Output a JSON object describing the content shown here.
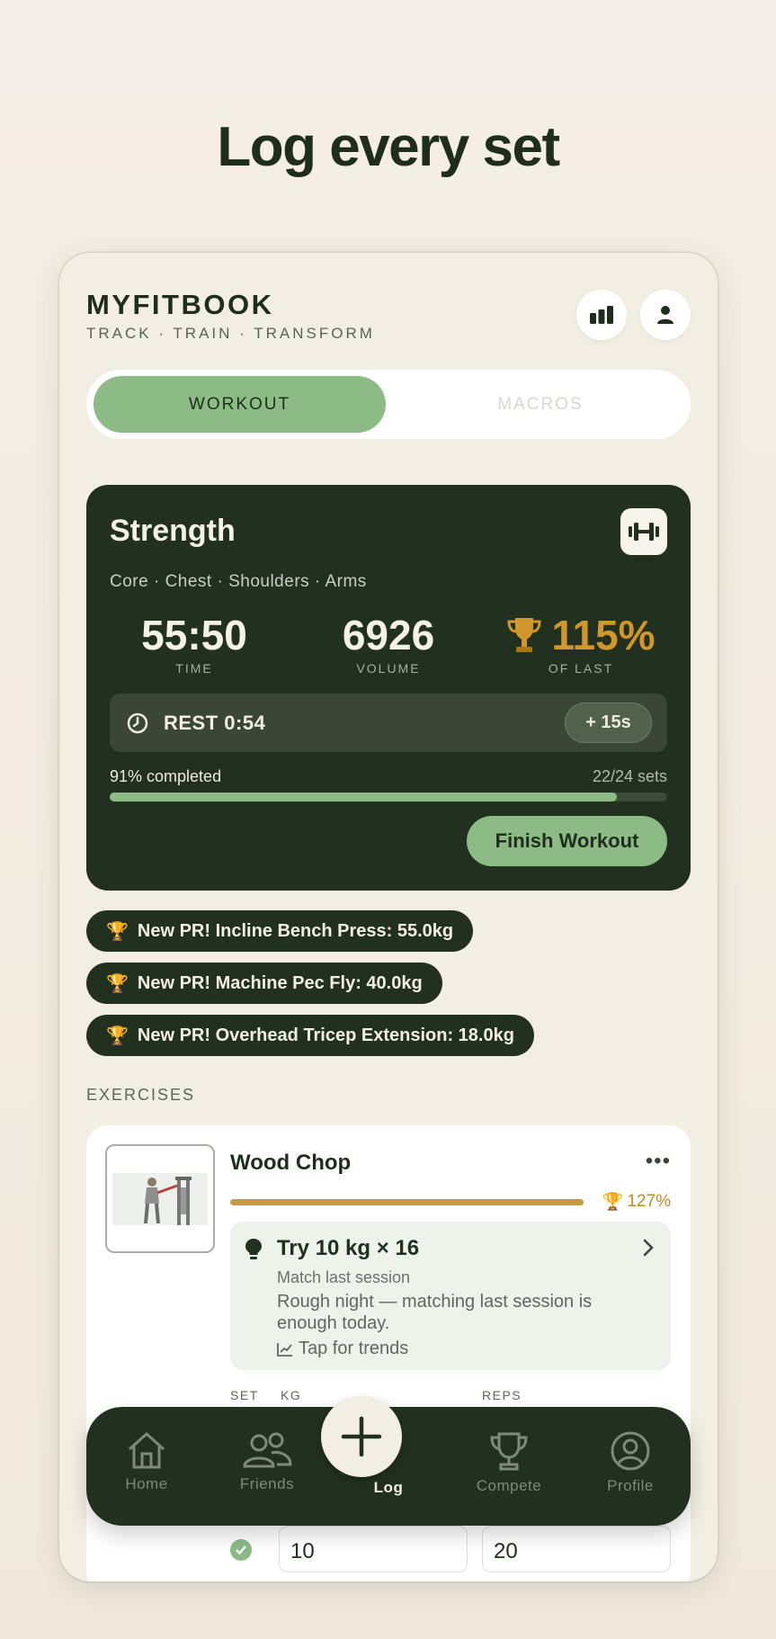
{
  "headline": "Log every set",
  "app": {
    "name": "MYFITBOOK",
    "tagline": "TRACK · TRAIN · TRANSFORM",
    "header_icons": [
      "bar-chart-icon",
      "user-icon"
    ]
  },
  "mode_tabs": {
    "active": "WORKOUT",
    "inactive": "MACROS"
  },
  "workout": {
    "title": "Strength",
    "muscles": "Core · Chest · Shoulders · Arms",
    "stats": [
      {
        "value": "55:50",
        "label": "TIME"
      },
      {
        "value": "6926",
        "label": "VOLUME"
      },
      {
        "value": "115%",
        "label": "OF LAST"
      }
    ],
    "rest_label": "REST 0:54",
    "add_rest_label": "+ 15s",
    "progress_text": "91% completed",
    "sets_text": "22/24 sets",
    "progress_fraction": 0.91,
    "finish_label": "Finish Workout"
  },
  "prs": [
    "New PR! Incline Bench Press: 55.0kg",
    "New PR! Machine Pec Fly: 40.0kg",
    "New PR! Overhead Tricep Extension: 18.0kg"
  ],
  "exercises_label": "EXERCISES",
  "exercise": {
    "name": "Wood Chop",
    "percent": "127%",
    "suggestion_title": "Try 10 kg × 16",
    "suggestion_sub": "Match last session",
    "suggestion_body": "Rough night — matching last session is enough today.",
    "trends_label": "Tap for trends",
    "columns": {
      "set": "SET",
      "kg": "KG",
      "reps": "REPS"
    },
    "row_values": {
      "kg": "10",
      "reps": "20"
    }
  },
  "nav": [
    {
      "label": "Home",
      "icon": "home-icon"
    },
    {
      "label": "Friends",
      "icon": "friends-icon"
    },
    {
      "label": "Log",
      "icon": "plus-icon"
    },
    {
      "label": "Compete",
      "icon": "trophy-icon"
    },
    {
      "label": "Profile",
      "icon": "profile-icon"
    }
  ],
  "colors": {
    "dark_green": "#21301f",
    "accent_green": "#8cbb86",
    "gold": "#d1962c",
    "cream": "#f3eee4"
  }
}
